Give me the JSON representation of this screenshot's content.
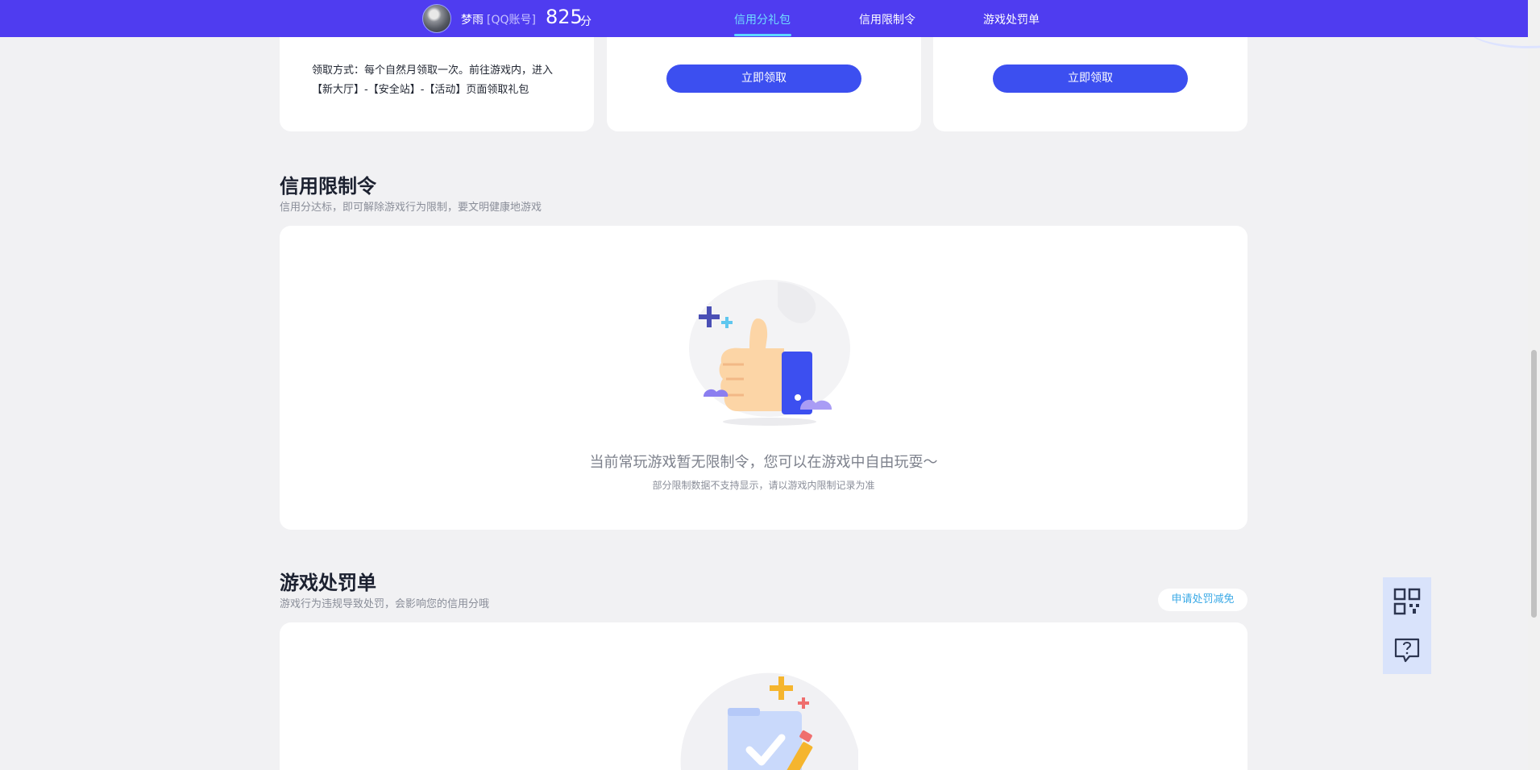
{
  "header": {
    "user_name": "梦雨",
    "account_type": "[QQ账号]",
    "score": "825",
    "score_unit": "分",
    "tabs": [
      {
        "label": "信用分礼包",
        "active": true
      },
      {
        "label": "信用限制令",
        "active": false
      },
      {
        "label": "游戏处罚单",
        "active": false
      }
    ]
  },
  "gift": {
    "method_text": "领取方式：每个自然月领取一次。前往游戏内，进入【新大厅】-【安全站】-【活动】页面领取礼包",
    "claim_label": "立即领取"
  },
  "restriction": {
    "title": "信用限制令",
    "subtitle": "信用分达标，即可解除游戏行为限制，要文明健康地游戏",
    "empty_main": "当前常玩游戏暂无限制令，您可以在游戏中自由玩耍～",
    "empty_hint": "部分限制数据不支持显示，请以游戏内限制记录为准"
  },
  "penalty": {
    "title": "游戏处罚单",
    "subtitle": "游戏行为违规导致处罚，会影响您的信用分哦",
    "appeal_label": "申请处罚减免"
  },
  "icons": {
    "qr": "qr-code-icon",
    "help": "help-chat-icon"
  },
  "colors": {
    "nav_bg": "#4f3cf0",
    "active_tab": "#6fdcff",
    "button": "#3c4ff0"
  }
}
